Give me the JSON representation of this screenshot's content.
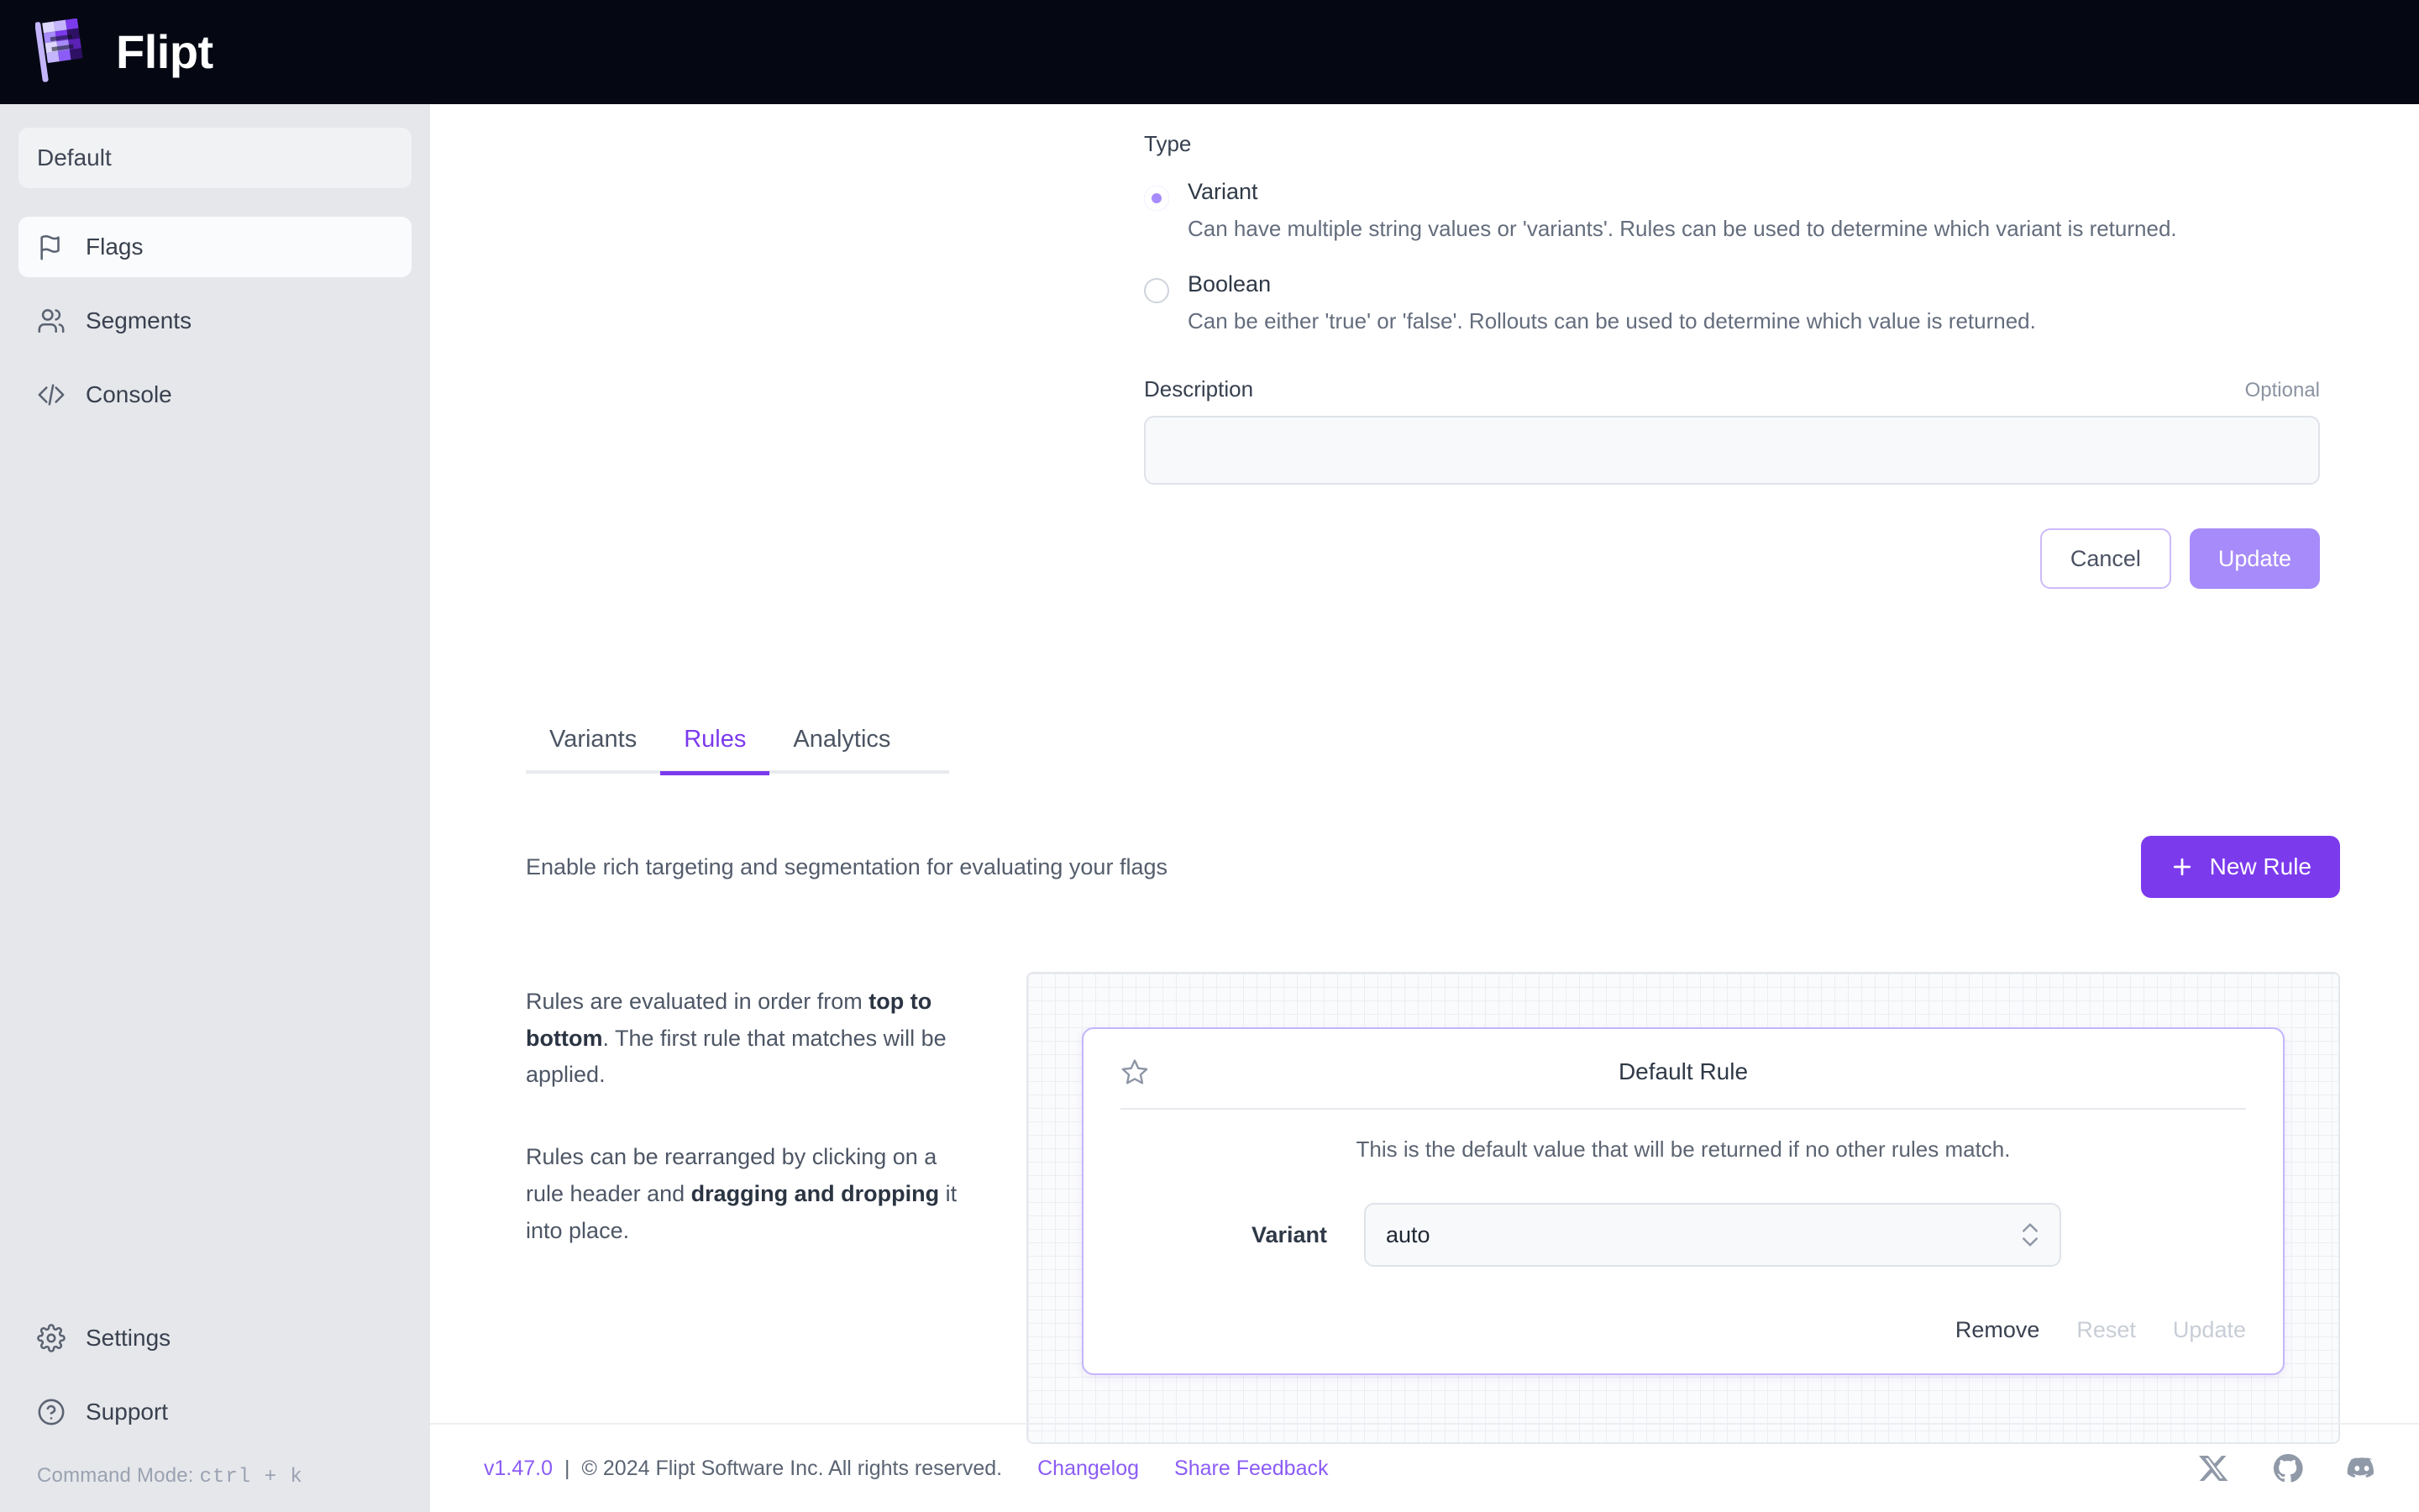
{
  "header": {
    "brand_name": "Flipt",
    "logo_icon": "flipt-flag-logo"
  },
  "sidebar": {
    "namespace": "Default",
    "items": [
      {
        "label": "Flags",
        "icon": "flag-icon",
        "active": true
      },
      {
        "label": "Segments",
        "icon": "users-icon",
        "active": false
      },
      {
        "label": "Console",
        "icon": "code-brackets-icon",
        "active": false
      }
    ],
    "bottom_items": [
      {
        "label": "Settings",
        "icon": "gear-icon"
      },
      {
        "label": "Support",
        "icon": "question-circle-icon"
      }
    ],
    "command_mode_label": "Command Mode:",
    "command_mode_keys": "ctrl + k"
  },
  "flag_form": {
    "type_label": "Type",
    "options": [
      {
        "label": "Variant",
        "description": "Can have multiple string values or 'variants'. Rules can be used to determine which variant is returned.",
        "selected": true
      },
      {
        "label": "Boolean",
        "description": "Can be either 'true' or 'false'. Rollouts can be used to determine which value is returned.",
        "selected": false
      }
    ],
    "description_label": "Description",
    "description_optional": "Optional",
    "description_value": "",
    "description_placeholder": "",
    "cancel_label": "Cancel",
    "update_label": "Update"
  },
  "tabs": [
    {
      "label": "Variants",
      "active": false
    },
    {
      "label": "Rules",
      "active": true
    },
    {
      "label": "Analytics",
      "active": false
    }
  ],
  "rules_section": {
    "subtitle": "Enable rich targeting and segmentation for evaluating your flags",
    "new_rule_label": "New Rule",
    "new_rule_icon": "plus-icon",
    "help": {
      "p1_a": "Rules are evaluated in order from ",
      "p1_b": "top to bottom",
      "p1_c": ". The first rule that matches will be applied.",
      "p2_a": "Rules can be rearranged by clicking on a rule header and ",
      "p2_b": "dragging and dropping",
      "p2_c": " it into place."
    },
    "default_rule": {
      "star_icon": "star-icon",
      "title": "Default Rule",
      "note": "This is the default value that will be returned if no other rules match.",
      "variant_label": "Variant",
      "variant_value": "auto",
      "actions": [
        {
          "label": "Remove",
          "enabled": true
        },
        {
          "label": "Reset",
          "enabled": false
        },
        {
          "label": "Update",
          "enabled": false
        }
      ]
    }
  },
  "footer": {
    "version": "v1.47.0",
    "separator": "|",
    "copyright": "© 2024 Flipt Software Inc. All rights reserved.",
    "links": [
      {
        "label": "Changelog"
      },
      {
        "label": "Share Feedback"
      }
    ],
    "social": [
      {
        "name": "x-twitter-icon"
      },
      {
        "name": "github-icon"
      },
      {
        "name": "discord-icon"
      }
    ]
  },
  "colors": {
    "brand_purple": "#7c3aed",
    "accent_light_purple": "#a78bfa",
    "header_bg": "#050813",
    "sidebar_bg": "#e5e7eb"
  }
}
